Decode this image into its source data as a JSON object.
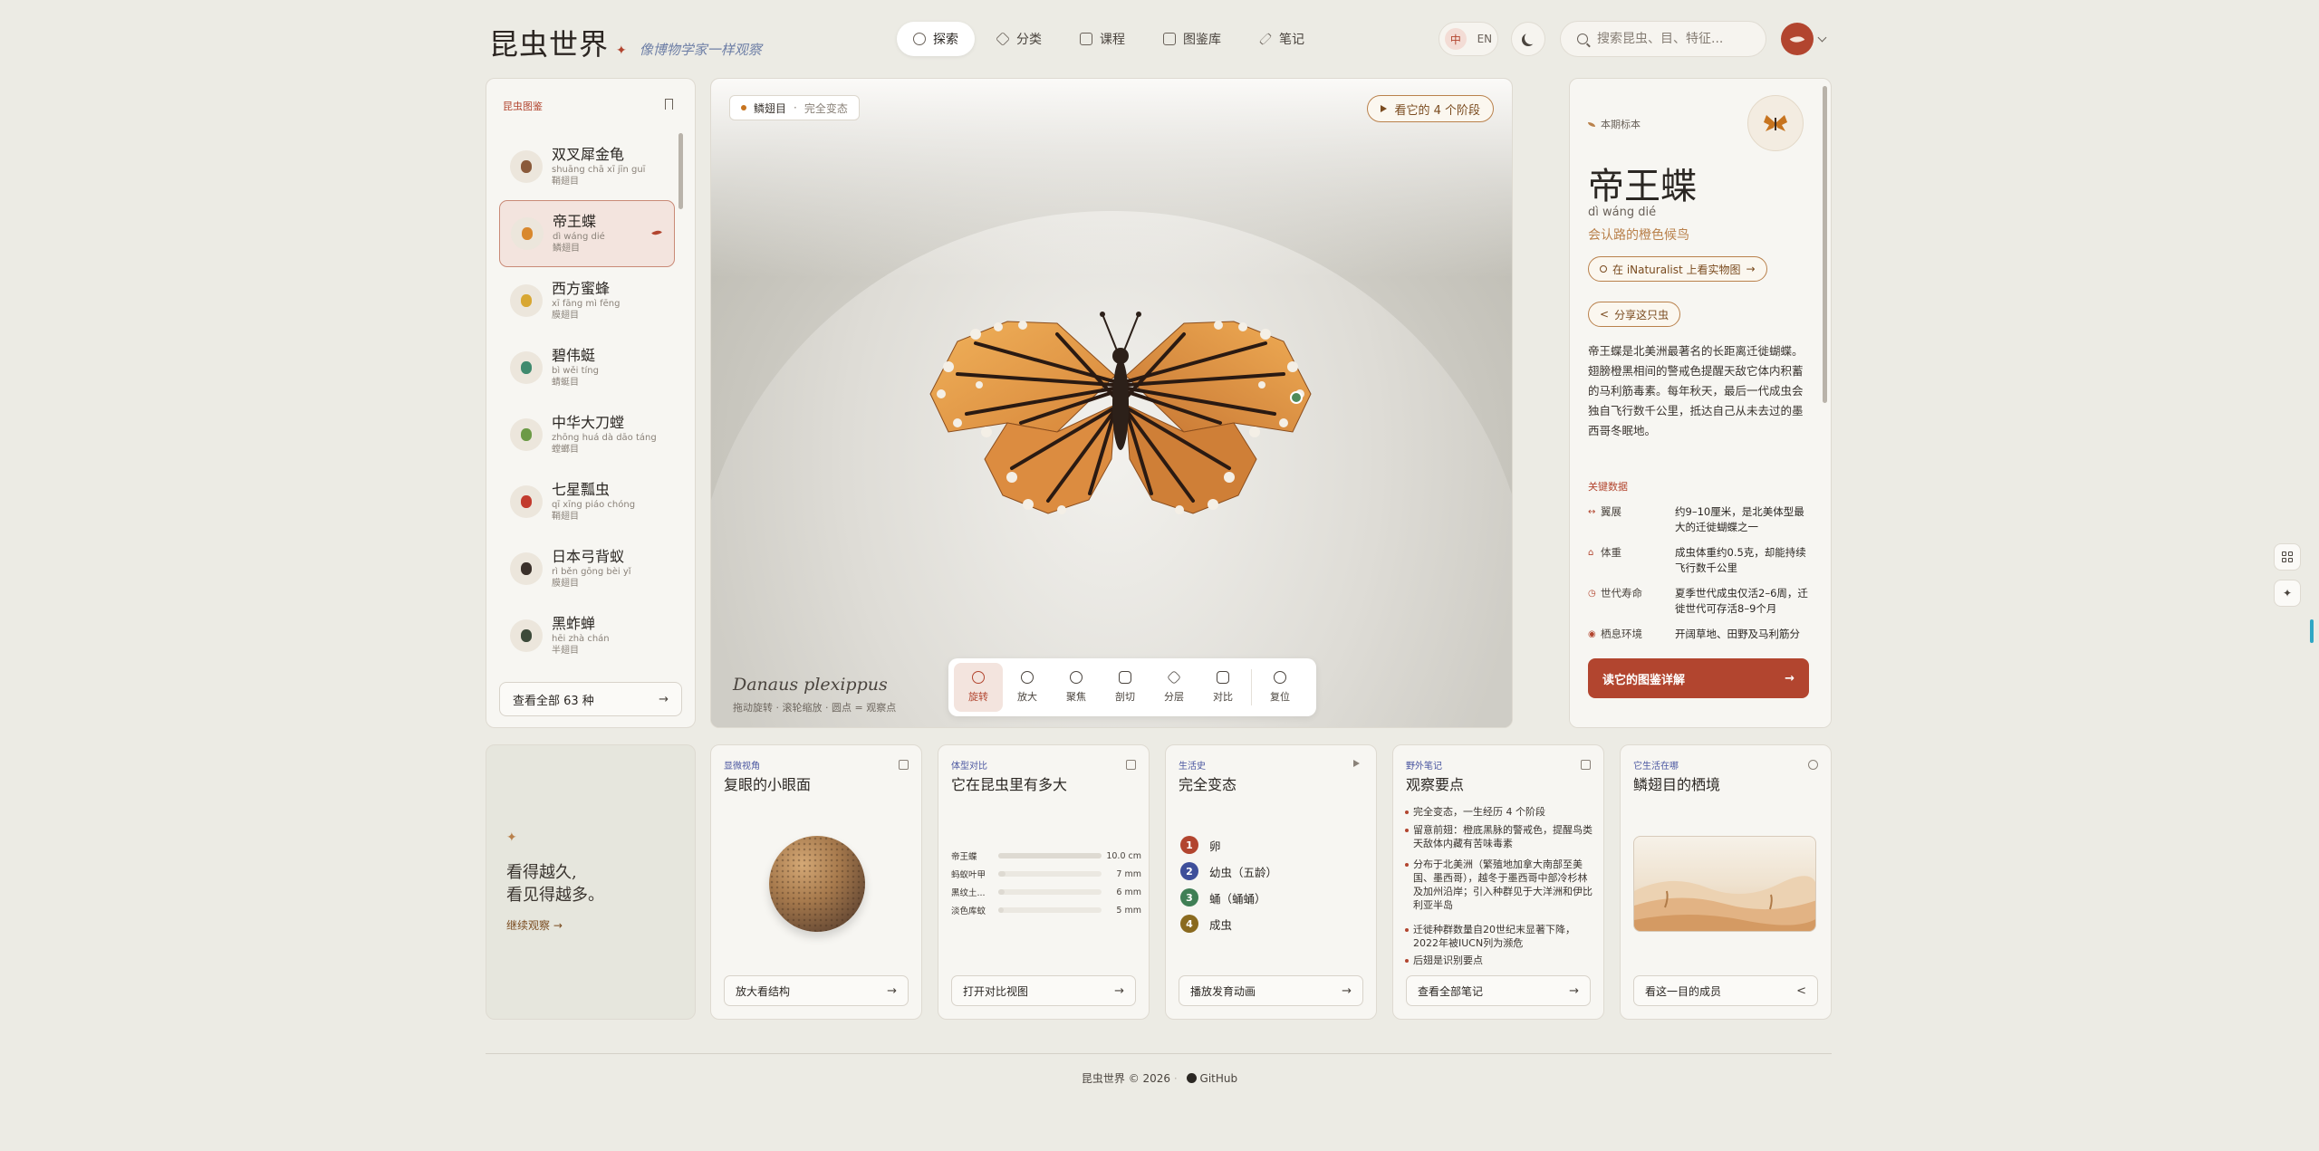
{
  "header": {
    "brand_title": "昆虫世界",
    "brand_subtitle": "像博物学家一样观察",
    "nav": [
      {
        "label": "探索",
        "active": true
      },
      {
        "label": "分类",
        "active": false
      },
      {
        "label": "课程",
        "active": false
      },
      {
        "label": "图鉴库",
        "active": false
      },
      {
        "label": "笔记",
        "active": false
      }
    ],
    "lang_active": "中",
    "lang_other": "EN",
    "search_placeholder": "搜索昆虫、目、特征..."
  },
  "sidebar": {
    "title": "昆虫图鉴",
    "items": [
      {
        "name": "双叉犀金龟",
        "pinyin": "shuāng chā xī jīn guī",
        "order": "鞘翅目",
        "color": "#8a5a3a"
      },
      {
        "name": "帝王蝶",
        "pinyin": "dì wáng dié",
        "order": "鳞翅目",
        "color": "#d9882e",
        "selected": true
      },
      {
        "name": "西方蜜蜂",
        "pinyin": "xī fāng mì fēng",
        "order": "膜翅目",
        "color": "#d8a733"
      },
      {
        "name": "碧伟蜓",
        "pinyin": "bì wěi tíng",
        "order": "蜻蜓目",
        "color": "#3f8a6e"
      },
      {
        "name": "中华大刀螳",
        "pinyin": "zhōng huá dà dāo táng",
        "order": "螳螂目",
        "color": "#6c9a46"
      },
      {
        "name": "七星瓢虫",
        "pinyin": "qī xīng piáo chóng",
        "order": "鞘翅目",
        "color": "#c23b2e"
      },
      {
        "name": "日本弓背蚁",
        "pinyin": "rì běn gōng bèi yǐ",
        "order": "膜翅目",
        "color": "#3a302a"
      },
      {
        "name": "黑蚱蝉",
        "pinyin": "hēi zhà chán",
        "order": "半翅目",
        "color": "#3d4a3a"
      }
    ],
    "view_all": "查看全部 63 种"
  },
  "stage": {
    "chip_order": "鳞翅目",
    "chip_meta": "完全变态",
    "stages_button": "看它的 4 个阶段",
    "latin_name": "Danaus plexippus",
    "hint": "拖动旋转 · 滚轮缩放 · 圆点 = 观察点",
    "tools": [
      {
        "label": "旋转",
        "icon": "rotate-icon",
        "active": true
      },
      {
        "label": "放大",
        "icon": "zoom-icon"
      },
      {
        "label": "聚焦",
        "icon": "focus-icon"
      },
      {
        "label": "剖切",
        "icon": "section-icon"
      },
      {
        "label": "分层",
        "icon": "layers-icon"
      },
      {
        "label": "对比",
        "icon": "compare-icon"
      },
      {
        "label": "复位",
        "icon": "reset-icon"
      }
    ]
  },
  "info": {
    "tag": "本期标本",
    "name": "帝王蝶",
    "pinyin": "dì wáng dié",
    "motto": "会认路的橙色候鸟",
    "inat_link": "在 iNaturalist 上看实物图",
    "share": "分享这只虫",
    "description": "帝王蝶是北美洲最著名的长距离迁徙蝴蝶。翅膀橙黑相间的警戒色提醒天敌它体内积蓄的马利筋毒素。每年秋天，最后一代成虫会独自飞行数千公里，抵达自己从未去过的墨西哥冬眠地。",
    "key_title": "关键数据",
    "key_data": [
      {
        "k": "翼展",
        "v": "约9–10厘米，是北美体型最大的迁徙蝴蝶之一"
      },
      {
        "k": "体重",
        "v": "成虫体重约0.5克，却能持续飞行数千公里"
      },
      {
        "k": "世代寿命",
        "v": "夏季世代成虫仅活2–6周，迁徙世代可存活8–9个月"
      },
      {
        "k": "栖息环境",
        "v": "开阔草地、田野及马利筋分"
      }
    ],
    "read_button": "读它的图鉴详解"
  },
  "bottom": {
    "quote_lines": [
      "看得越久,",
      "看见得越多。"
    ],
    "quote_link": "继续观察 →",
    "eye_card": {
      "tag": "显微视角",
      "title": "复眼的小眼面",
      "button": "放大看结构"
    },
    "size_card": {
      "tag": "体型对比",
      "title": "它在昆虫里有多大",
      "button": "打开对比视图",
      "rows": [
        {
          "name": "帝王蝶",
          "value": "10.0 cm",
          "frac": 1.0
        },
        {
          "name": "蚂蚁叶甲",
          "value": "7 mm",
          "frac": 0.07
        },
        {
          "name": "黑纹土...",
          "value": "6 mm",
          "frac": 0.06
        },
        {
          "name": "淡色库蚊",
          "value": "5 mm",
          "frac": 0.05
        }
      ]
    },
    "life_card": {
      "tag": "生活史",
      "title": "完全变态",
      "button": "播放发育动画",
      "stages": [
        {
          "n": "1",
          "label": "卵",
          "color": "#b2452f"
        },
        {
          "n": "2",
          "label": "幼虫（五龄）",
          "color": "#3e4f9a"
        },
        {
          "n": "3",
          "label": "蛹（蛹蛹）",
          "color": "#3f7f55"
        },
        {
          "n": "4",
          "label": "成虫",
          "color": "#8a6a1f"
        }
      ]
    },
    "notes_card": {
      "tag": "野外笔记",
      "title": "观察要点",
      "button": "查看全部笔记",
      "notes": [
        "完全变态，一生经历 4 个阶段",
        "留意前翅：橙底黑脉的警戒色，提醒鸟类天敌体内藏有苦味毒素",
        "分布于北美洲（繁殖地加拿大南部至美国、墨西哥），越冬于墨西哥中部冷杉林及加州沿岸；引入种群见于大洋洲和伊比利亚半岛",
        "迁徙种群数量自20世纪末显著下降，2022年被IUCN列为濒危",
        "后翅是识别要点"
      ]
    },
    "habitat_card": {
      "tag": "它生活在哪",
      "title": "鳞翅目的栖境",
      "button": "看这一目的成员"
    }
  },
  "footer": {
    "copyright": "昆虫世界 © 2026",
    "github": "GitHub"
  },
  "colors": {
    "accent": "#b2452f",
    "gold": "#b9814c",
    "bg": "#ecebe4"
  }
}
